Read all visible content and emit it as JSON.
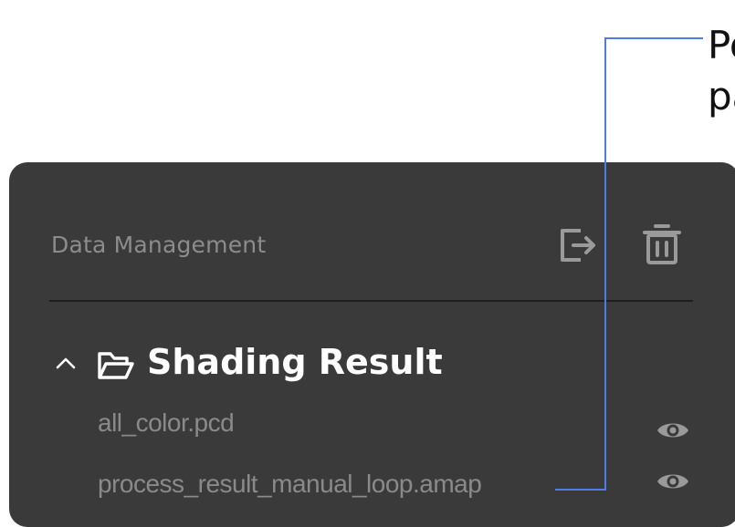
{
  "callout": {
    "line1": "Po",
    "line2": "pa"
  },
  "panel": {
    "title": "Data Management",
    "export_icon": "export-icon",
    "delete_icon": "trash-icon"
  },
  "folder": {
    "label": "Shading Result",
    "expanded": true,
    "chevron_icon": "chevron-up-icon",
    "folder_icon": "folder-open-icon"
  },
  "files": [
    {
      "name": "all_color.pcd",
      "visibility_icon": "eye-icon"
    },
    {
      "name": "process_result_manual_loop.amap",
      "visibility_icon": "eye-icon"
    }
  ],
  "colors": {
    "panel_bg": "#3a3a3a",
    "header_text": "#8c8c8c",
    "folder_text": "#ffffff",
    "file_text": "#8a8a8a",
    "icon_color": "#9a9a9a",
    "leader_line": "#4f7be8"
  }
}
